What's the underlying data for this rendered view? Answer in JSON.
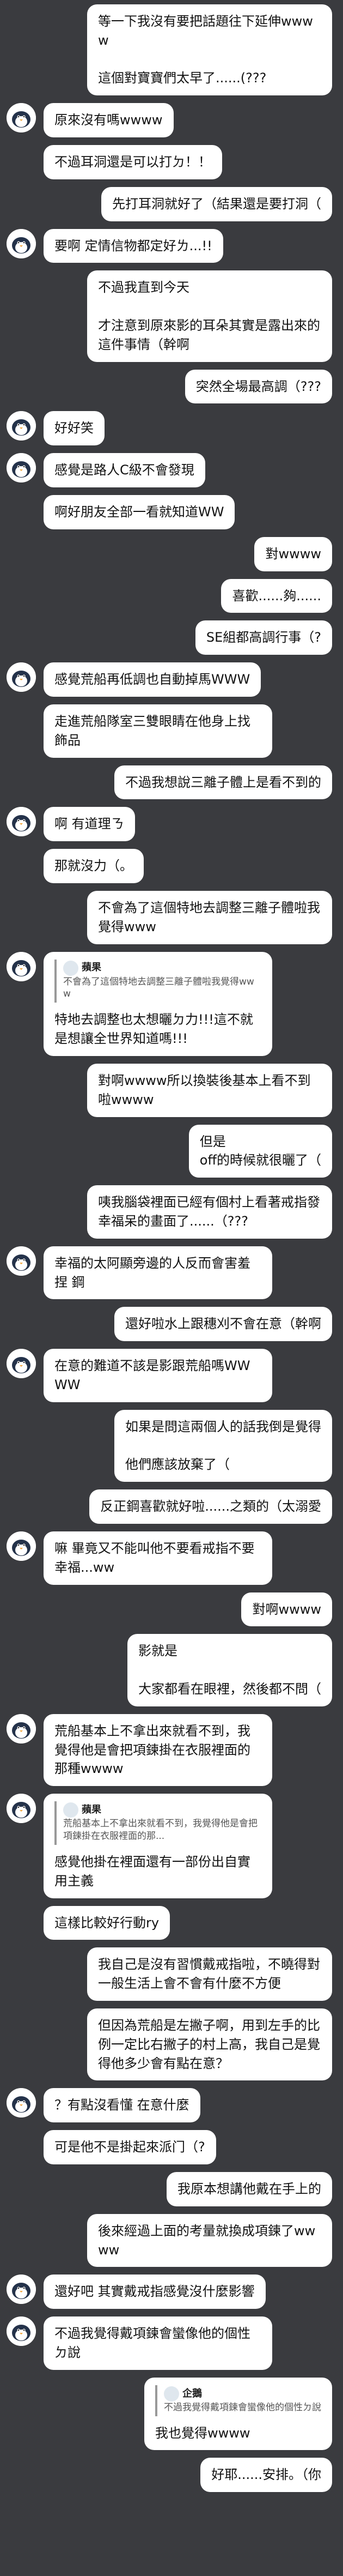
{
  "messages": [
    {
      "side": "right",
      "text": "等一下我沒有要把話題往下延伸wwww\n\n這個對寶寶們太早了......(???"
    },
    {
      "side": "left",
      "avatar": true,
      "text": "原來沒有嗎wwww"
    },
    {
      "side": "left",
      "avatar": false,
      "text": "不過耳洞還是可以打ㄉ！！"
    },
    {
      "side": "right",
      "text": "先打耳洞就好了（結果還是要打洞（"
    },
    {
      "side": "left",
      "avatar": true,
      "text": "要啊 定情信物都定好ㄌ...!!"
    },
    {
      "side": "right",
      "text": "不過我直到今天\n\n才注意到原來影的耳朵其實是露出來的這件事情（幹啊"
    },
    {
      "side": "right",
      "text": "突然全場最高調（???"
    },
    {
      "side": "left",
      "avatar": true,
      "text": "好好笑"
    },
    {
      "side": "left",
      "avatar": true,
      "text": "感覺是路人C級不會發現"
    },
    {
      "side": "left",
      "avatar": false,
      "text": "啊好朋友全部一看就知道WW"
    },
    {
      "side": "right",
      "text": "對wwww"
    },
    {
      "side": "right",
      "text": "喜歡......夠......"
    },
    {
      "side": "right",
      "text": "SE組都高調行事（?"
    },
    {
      "side": "left",
      "avatar": true,
      "text": "感覺荒船再低調也自動掉馬WWW"
    },
    {
      "side": "left",
      "avatar": false,
      "text": "走進荒船隊室三雙眼睛在他身上找飾品"
    },
    {
      "side": "right",
      "text": "不過我想說三離子體上是看不到的"
    },
    {
      "side": "left",
      "avatar": true,
      "text": "啊 有道理ㄋ"
    },
    {
      "side": "left",
      "avatar": false,
      "text": "那就沒力（。"
    },
    {
      "side": "right",
      "text": "不會為了這個特地去調整三離子體啦我覺得www"
    },
    {
      "side": "left",
      "avatar": true,
      "reply": {
        "name": "蘋果",
        "text": "不會為了這個特地去調整三離子體啦我覺得www"
      },
      "text": "特地去調整也太想曬ㄉ力!!!這不就是想讓全世界知道嗎!!!"
    },
    {
      "side": "right",
      "text": "對啊wwww所以換裝後基本上看不到啦wwww"
    },
    {
      "side": "right",
      "text": "但是\noff的時候就很曬了（"
    },
    {
      "side": "right",
      "text": "咦我腦袋裡面已經有個村上看著戒指發幸福呆的畫面了......（???"
    },
    {
      "side": "left",
      "avatar": true,
      "text": "幸福的太阿顯旁邊的人反而會害羞捏 鋼"
    },
    {
      "side": "right",
      "text": "還好啦水上跟穗刈不會在意（幹啊"
    },
    {
      "side": "left",
      "avatar": true,
      "text": "在意的難道不該是影跟荒船嗎WWWW"
    },
    {
      "side": "right",
      "text": "如果是問這兩個人的話我倒是覺得\n\n他們應該放棄了（"
    },
    {
      "side": "right",
      "text": "反正鋼喜歡就好啦......之類的（太溺愛"
    },
    {
      "side": "left",
      "avatar": true,
      "text": "嘛 畢竟又不能叫他不要看戒指不要幸福...ww"
    },
    {
      "side": "right",
      "text": "對啊wwww"
    },
    {
      "side": "right",
      "text": "影就是\n\n大家都看在眼裡，然後都不問（"
    },
    {
      "side": "left",
      "avatar": true,
      "text": "荒船基本上不拿出來就看不到，我覺得他是會把項鍊掛在衣服裡面的那種wwww"
    },
    {
      "side": "left",
      "avatar": true,
      "reply": {
        "name": "蘋果",
        "text": "荒船基本上不拿出來就看不到，我覺得他是會把項鍊掛在衣服裡面的那..."
      },
      "text": "感覺他掛在裡面還有一部份出自實用主義"
    },
    {
      "side": "left",
      "avatar": false,
      "text": "這樣比較好行動ry"
    },
    {
      "side": "right",
      "text": "我自己是沒有習慣戴戒指啦，不曉得對一般生活上會不會有什麼不方便"
    },
    {
      "side": "right",
      "text": "但因為荒船是左撇子啊，用到左手的比例一定比右撇子的村上高，我自己是覺得他多少會有點在意？"
    },
    {
      "side": "left",
      "avatar": true,
      "text": "？有點沒看懂 在意什麼"
    },
    {
      "side": "left",
      "avatar": false,
      "text": "可是他不是掛起來派门（?"
    },
    {
      "side": "right",
      "text": "我原本想講他戴在手上的"
    },
    {
      "side": "right",
      "text": "後來經過上面的考量就換成項鍊了wwww"
    },
    {
      "side": "left",
      "avatar": true,
      "text": "還好吧 其實戴戒指感覺沒什麼影響"
    },
    {
      "side": "left",
      "avatar": true,
      "text": "不過我覺得戴項鍊會蠻像他的個性ㄉ說"
    },
    {
      "side": "right",
      "reply": {
        "name": "企鵝",
        "text": "不過我覺得戴項鍊會蠻像他的個性ㄉ說"
      },
      "text": "我也覺得wwww"
    },
    {
      "side": "right",
      "text": "好耶......安排。（你"
    }
  ]
}
